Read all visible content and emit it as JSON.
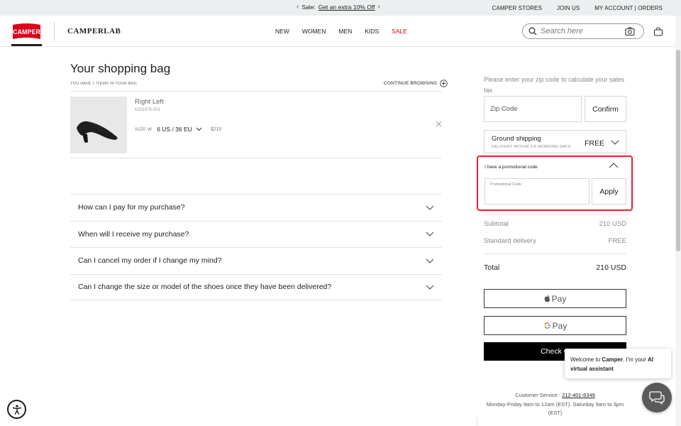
{
  "promo_bar": {
    "text": "Sale:",
    "link": "Get an extra 10% Off",
    "links": [
      "CAMPER STORES",
      "JOIN US",
      "MY ACCOUNT | ORDERS"
    ]
  },
  "header": {
    "logo_text": "CAMPER",
    "brand2": "CAMPERLAB",
    "nav": [
      "NEW",
      "WOMEN",
      "MEN",
      "KIDS",
      "SALE"
    ],
    "search_placeholder": "Search here"
  },
  "bag": {
    "title": "Your shopping bag",
    "items_count": "YOU HAVE 1 ITEMS IN YOUR BAG",
    "continue": "CONTINUE BROWSING",
    "item": {
      "name": "Right Left",
      "ref": "K201976-001",
      "size_label": "SIZE W",
      "size_value": "6 US / 36 EU",
      "price": "$210"
    }
  },
  "faq": [
    "How can I pay for my purchase?",
    "When will I receive my purchase?",
    "Can I cancel my order if I change my mind?",
    "Can I change the size or model of the shoes once they have been delivered?"
  ],
  "summary": {
    "zip_note": "Please enter your zip code to calculate your sales tax",
    "zip_placeholder": "Zip Code",
    "confirm": "Confirm",
    "shipping_title": "Ground shipping",
    "shipping_sub": "DELIVERY WITHIN 3-8 WORKING DAYS",
    "shipping_price": "FREE",
    "promo_title": "I have a promotional code",
    "promo_label": "Promotional Code",
    "apply": "Apply",
    "subtotal_label": "Subtotal",
    "subtotal_value": "210 USD",
    "delivery_label": "Standard delivery",
    "delivery_value": "FREE",
    "total_label": "Total",
    "total_value": "210 USD",
    "apple_pay": "Pay",
    "google_pay": "Pay",
    "checkout": "Check O",
    "service_label": "Customer Service :",
    "service_phone": "212-401-6349",
    "service_hours": "Monday-Friday 9am to 12am (EST). Saturday 9am to 3pm (EST)"
  },
  "chat": {
    "t1": "Welcome to ",
    "brand": "Camper",
    "t2": ", I'm your ",
    "ai": "AI virtual assistant"
  },
  "colors": {
    "sale": "#d9001b",
    "logo": "#d9001b",
    "highlight": "#e0252b",
    "checkout_bg": "#000000"
  }
}
